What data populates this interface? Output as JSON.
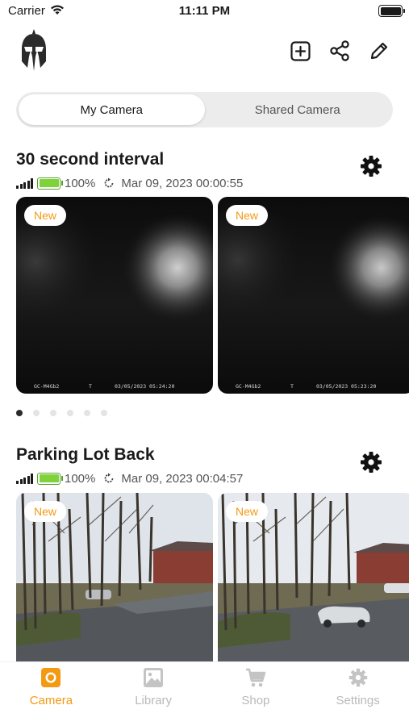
{
  "status_bar": {
    "carrier": "Carrier",
    "time": "11:11 PM"
  },
  "header": {
    "logo_icon": "spartan-helmet-icon",
    "actions": [
      {
        "name": "add",
        "icon": "add-square-icon"
      },
      {
        "name": "share",
        "icon": "share-icon"
      },
      {
        "name": "edit",
        "icon": "pencil-icon"
      }
    ]
  },
  "segment": {
    "tabs": [
      "My Camera",
      "Shared Camera"
    ],
    "selected": "My Camera"
  },
  "cameras": [
    {
      "title": "30 second interval",
      "battery_percent": "100%",
      "last_update": "Mar 09, 2023 00:00:55",
      "photos": [
        {
          "badge": "New",
          "caption_model": "GC-M4Gb2",
          "caption_mode": "T",
          "caption_datetime": "03/05/2023 05:24:20"
        },
        {
          "badge": "New",
          "caption_model": "GC-M4Gb2",
          "caption_mode": "T",
          "caption_datetime": "03/05/2023 05:23:20"
        }
      ],
      "page_count": 6,
      "current_page": 1
    },
    {
      "title": "Parking Lot Back",
      "battery_percent": "100%",
      "last_update": "Mar 09, 2023 00:04:57",
      "photos": [
        {
          "badge": "New"
        },
        {
          "badge": "New"
        }
      ]
    }
  ],
  "tabbar": {
    "items": [
      {
        "label": "Camera",
        "icon": "camera-icon",
        "active": true
      },
      {
        "label": "Library",
        "icon": "library-icon",
        "active": false
      },
      {
        "label": "Shop",
        "icon": "cart-icon",
        "active": false
      },
      {
        "label": "Settings",
        "icon": "gear-icon",
        "active": false
      }
    ]
  },
  "colors": {
    "accent": "#f39a12",
    "battery_green": "#7ed33a",
    "inactive_tab": "#b9b9b9"
  }
}
